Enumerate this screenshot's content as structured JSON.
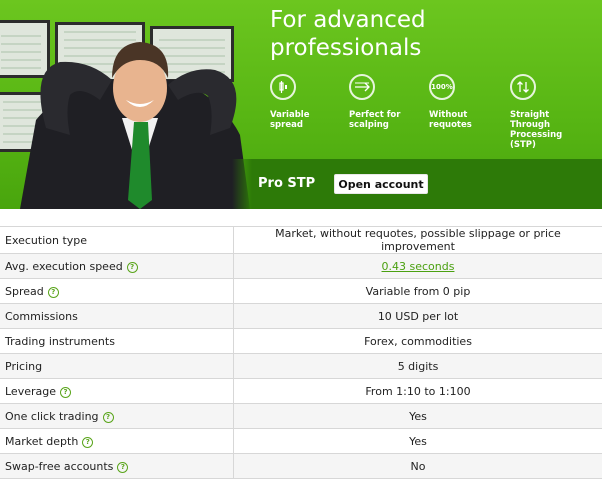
{
  "banner": {
    "headline_line1": "For advanced",
    "headline_line2": "professionals",
    "features": [
      {
        "icon": "candlestick-icon",
        "label_lines": [
          "Variable",
          "spread"
        ]
      },
      {
        "icon": "scalping-arrows-icon",
        "label_lines": [
          "Perfect for",
          "scalping"
        ]
      },
      {
        "icon": "hundred-percent-icon",
        "label_lines": [
          "Without",
          "requotes"
        ]
      },
      {
        "icon": "up-down-arrows-icon",
        "label_lines": [
          "Straight",
          "Through",
          "Processing",
          "(STP)"
        ]
      }
    ],
    "account_name": "Pro STP",
    "open_account_label": "Open account"
  },
  "table": {
    "rows": [
      {
        "label": "Execution type",
        "value": "Market, without requotes, possible slippage or price improvement",
        "help": false,
        "link": false
      },
      {
        "label": "Avg. execution speed",
        "value": "0.43 seconds",
        "help": true,
        "link": true
      },
      {
        "label": "Spread",
        "value": "Variable from 0 pip",
        "help": true,
        "link": false
      },
      {
        "label": "Commissions",
        "value": "10 USD per lot",
        "help": false,
        "link": false
      },
      {
        "label": "Trading instruments",
        "value": "Forex, commodities",
        "help": false,
        "link": false
      },
      {
        "label": "Pricing",
        "value": "5 digits",
        "help": false,
        "link": false
      },
      {
        "label": "Leverage",
        "value": "From 1:10 to 1:100",
        "help": true,
        "link": false
      },
      {
        "label": "One click trading",
        "value": "Yes",
        "help": true,
        "link": false
      },
      {
        "label": "Market depth",
        "value": "Yes",
        "help": true,
        "link": false
      },
      {
        "label": "Swap-free accounts",
        "value": "No",
        "help": true,
        "link": false
      }
    ]
  },
  "colors": {
    "brand_green": "#58b614",
    "dark_green": "#2d7a08",
    "link_green": "#4aa010"
  }
}
